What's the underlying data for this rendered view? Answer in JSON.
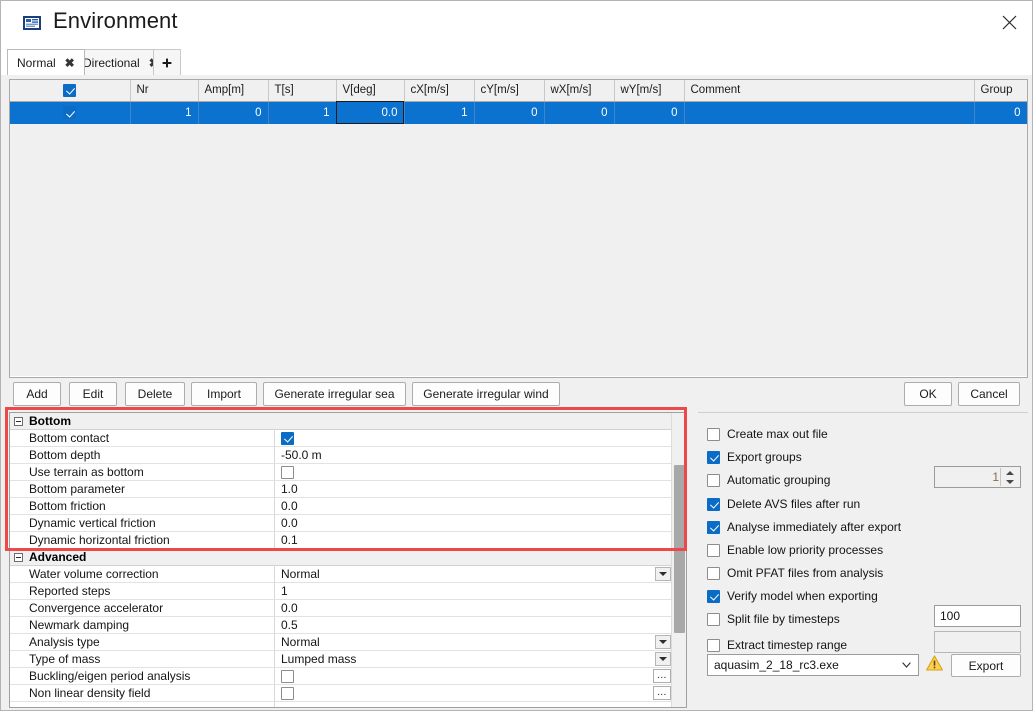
{
  "window": {
    "title": "Environment",
    "icon": "environment-icon",
    "close_label": "✕"
  },
  "tabs": {
    "items": [
      {
        "label": "Normal",
        "active": true,
        "close": "✖"
      },
      {
        "label": "Directional",
        "active": false,
        "close": "✖"
      }
    ],
    "add_label": "＋"
  },
  "grid": {
    "columns": [
      {
        "key": "check",
        "label": "",
        "type": "checkbox"
      },
      {
        "key": "nr",
        "label": "Nr"
      },
      {
        "key": "amp",
        "label": "Amp[m]"
      },
      {
        "key": "t",
        "label": "T[s]"
      },
      {
        "key": "v",
        "label": "V[deg]"
      },
      {
        "key": "cx",
        "label": "cX[m/s]"
      },
      {
        "key": "cy",
        "label": "cY[m/s]"
      },
      {
        "key": "wx",
        "label": "wX[m/s]"
      },
      {
        "key": "wy",
        "label": "wY[m/s]"
      },
      {
        "key": "comment",
        "label": "Comment"
      },
      {
        "key": "group",
        "label": "Group"
      }
    ],
    "header_checkbox_checked": true,
    "rows": [
      {
        "checked": true,
        "nr": "1",
        "amp": "0",
        "t": "1",
        "v": "0.0",
        "cx": "1",
        "cy": "0",
        "wx": "0",
        "wy": "0",
        "comment": "",
        "group": "0",
        "selected": true,
        "focus_column": "v"
      }
    ]
  },
  "actions": {
    "add": "Add",
    "edit": "Edit",
    "delete": "Delete",
    "import": "Import",
    "generate_sea": "Generate irregular sea",
    "generate_wind": "Generate irregular wind",
    "ok": "OK",
    "cancel": "Cancel"
  },
  "property_grid": {
    "categories": [
      {
        "name": "Bottom",
        "rows": [
          {
            "label": "Bottom contact",
            "type": "checkbox",
            "checked": true
          },
          {
            "label": "Bottom depth",
            "type": "text",
            "value": "-50.0 m"
          },
          {
            "label": "Use terrain as bottom",
            "type": "checkbox",
            "checked": false
          },
          {
            "label": "Bottom parameter",
            "type": "text",
            "value": "1.0"
          },
          {
            "label": "Bottom friction",
            "type": "text",
            "value": "0.0"
          },
          {
            "label": "Dynamic vertical friction",
            "type": "text",
            "value": "0.0"
          },
          {
            "label": "Dynamic horizontal friction",
            "type": "text",
            "value": "0.1"
          }
        ]
      },
      {
        "name": "Advanced",
        "rows": [
          {
            "label": "Water volume correction",
            "type": "dropdown",
            "value": "Normal"
          },
          {
            "label": "Reported steps",
            "type": "text",
            "value": "1"
          },
          {
            "label": "Convergence accelerator",
            "type": "text",
            "value": "0.0"
          },
          {
            "label": "Newmark damping",
            "type": "text",
            "value": "0.5"
          },
          {
            "label": "Analysis type",
            "type": "dropdown",
            "value": "Normal"
          },
          {
            "label": "Type of mass",
            "type": "dropdown",
            "value": "Lumped mass"
          },
          {
            "label": "Buckling/eigen period analysis",
            "type": "checkbox-ellipsis",
            "checked": false,
            "ellipsis": "…"
          },
          {
            "label": "Non linear density field",
            "type": "checkbox-ellipsis",
            "checked": false,
            "ellipsis": "…"
          }
        ]
      }
    ]
  },
  "options": {
    "checkboxes": [
      {
        "label": "Create max out file",
        "checked": false
      },
      {
        "label": "Export groups",
        "checked": true
      },
      {
        "label": "Automatic grouping",
        "checked": false
      },
      {
        "label": "Delete AVS files after run",
        "checked": true
      },
      {
        "label": "Analyse immediately after export",
        "checked": true
      },
      {
        "label": "Enable low priority processes",
        "checked": false
      },
      {
        "label": "Omit PFAT files from analysis",
        "checked": false
      },
      {
        "label": "Verify model when exporting",
        "checked": true
      },
      {
        "label": "Split file by timesteps",
        "checked": false
      },
      {
        "label": "Extract timestep range",
        "checked": false
      }
    ],
    "grouping_spinner_value": "1",
    "split_timesteps_value": "100",
    "extract_range_value": "",
    "solver_value": "aquasim_2_18_rc3.exe",
    "warning_icon": "warning-triangle-icon",
    "export_label": "Export"
  },
  "colors": {
    "selection_blue": "#0b72cf",
    "checkbox_blue": "#0a6cc4",
    "annotation_red": "#ec4a4a",
    "warning_amber": "#f0b429"
  }
}
